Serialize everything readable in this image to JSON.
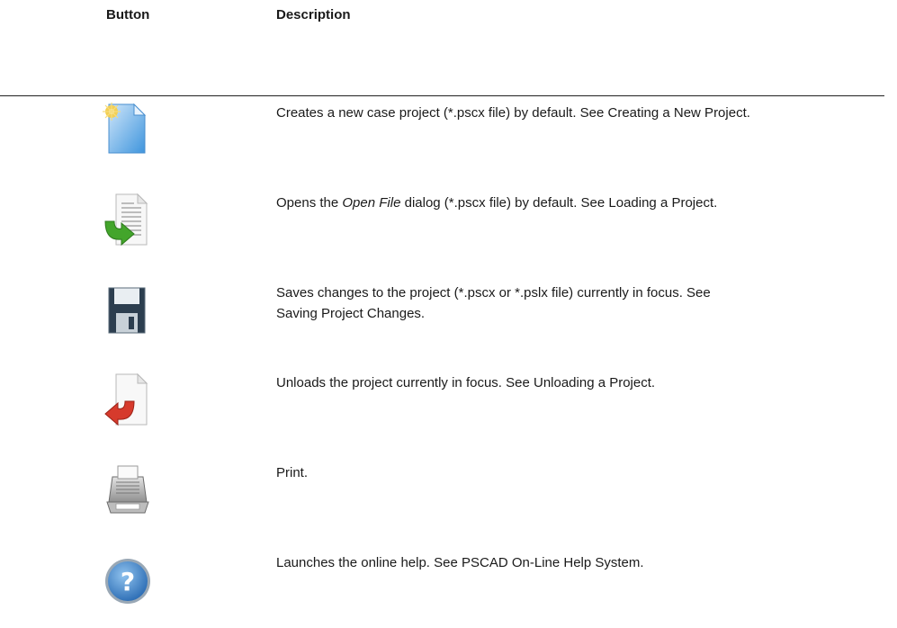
{
  "table": {
    "header_button": "Button",
    "header_description": "Description",
    "rows": [
      {
        "icon": "new-project-icon",
        "text": "Creates a new case project (*.pscx file) by default. See Creating a New Project."
      },
      {
        "icon": "open-file-icon",
        "pre": "Opens the ",
        "em": "Open File",
        "post": " dialog (*.pscx file) by default. See Loading a Project."
      },
      {
        "icon": "save-icon",
        "line1": "Saves changes to the project (*.pscx or *.pslx file) currently in focus. See",
        "line2": "Saving Project Changes."
      },
      {
        "icon": "unload-project-icon",
        "text": "Unloads the project currently in focus. See Unloading a Project."
      },
      {
        "icon": "printer-icon",
        "text": "Print."
      },
      {
        "icon": "help-icon",
        "text": "Launches the online help. See PSCAD On-Line Help System."
      }
    ]
  }
}
